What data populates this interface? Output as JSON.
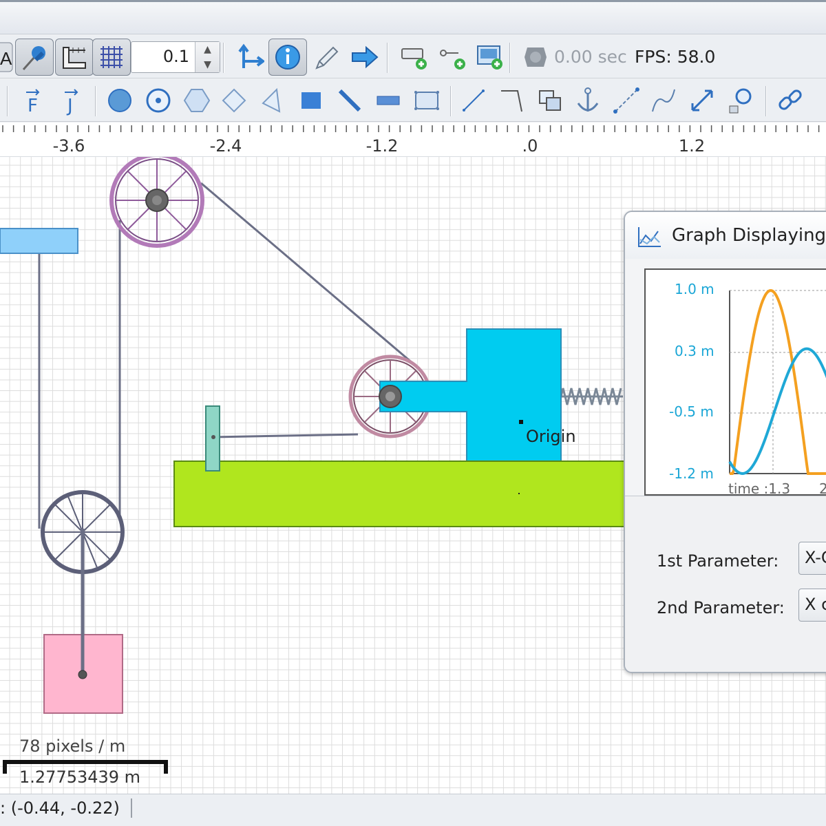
{
  "toolbar": {
    "step_value": "0.1",
    "timer": "0.00 sec",
    "fps": "FPS: 58.0"
  },
  "ruler": {
    "labels": [
      "-3.6",
      "-2.4",
      "-1.2",
      ".0",
      "1.2"
    ]
  },
  "canvas": {
    "origin_label": "Origin",
    "scale_pixels": "78 pixels / m",
    "scale_length": "1.27753439 m"
  },
  "graph": {
    "title": "Graph Displaying",
    "y_ticks": [
      "1.0 m",
      "0.3 m",
      "-0.5 m",
      "-1.2 m"
    ],
    "x_tick_0": "time :1.3",
    "x_tick_1": "2",
    "param1_label": "1st  Parameter:",
    "param1_value": "X-C",
    "param2_label": "2nd Parameter:",
    "param2_value": "X c",
    "colors": {
      "series1": "#f4a020",
      "series2": "#1fa8d6"
    }
  },
  "status": {
    "coordinates": ": (-0.44, -0.22)"
  },
  "icons": {
    "toolbar1": [
      "text-tool-icon",
      "pin-icon",
      "ruler-icon",
      "grid-icon",
      "axes-icon",
      "info-icon",
      "pen-icon",
      "arrow-right-icon",
      "add-field-icon",
      "add-node-icon",
      "add-image-icon",
      "gear-timer-icon"
    ],
    "toolbar2": [
      "force-icon",
      "impulse-icon",
      "circle-icon",
      "ring-icon",
      "polygon-icon",
      "diamond-icon",
      "triangle-icon",
      "rectangle-icon",
      "rod-icon",
      "plank-icon",
      "soft-body-icon",
      "line-icon",
      "corner-joint-icon",
      "overlap-icon",
      "anchor-icon",
      "chain-icon",
      "curve-icon",
      "measure-icon",
      "tracker-icon",
      "link-icon"
    ]
  }
}
